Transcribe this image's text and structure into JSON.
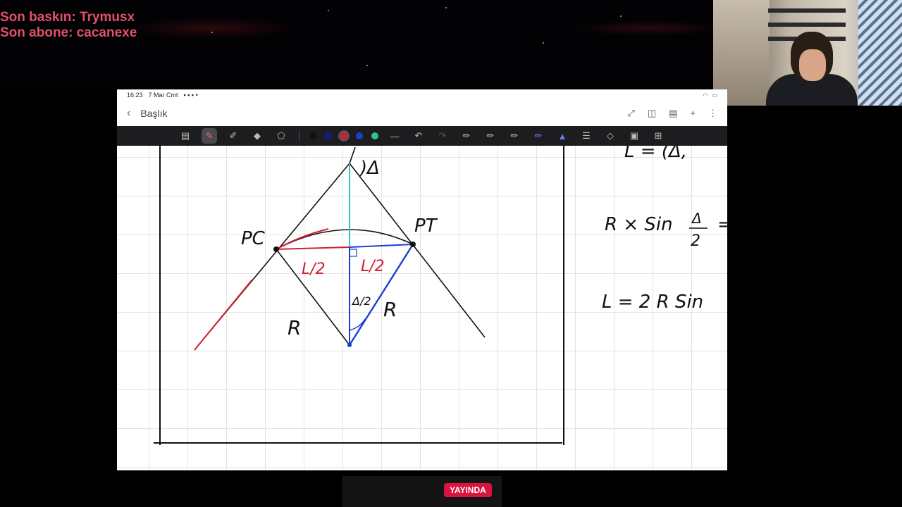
{
  "overlay": {
    "last_raid": "Son baskın: Trymusx",
    "last_sub": "Son abone: cacanexe"
  },
  "tablet": {
    "status_time": "16:23",
    "status_date": "7 Mar Cmt",
    "title": "Başlık"
  },
  "toolbar": {
    "colors": [
      "#111111",
      "#0a1f8f",
      "#d02030",
      "#1a3fd0",
      "#2ec48c"
    ]
  },
  "note": {
    "label_pc": "PC",
    "label_pt": "PT",
    "label_delta": ")Δ",
    "label_l_half_left": "L/2",
    "label_l_half_right": "L/2",
    "label_r_left": "R",
    "label_r_right": "R",
    "label_delta_half": "Δ/2",
    "eq1_left": "R × Sin",
    "eq1_frac_top": "Δ",
    "eq1_frac_bottom": "2",
    "eq1_tail": "=",
    "eq2": "L = 2 R Sin",
    "top_right_partial": "L = (Δ,"
  },
  "stream": {
    "live_label": "YAYINDA"
  }
}
